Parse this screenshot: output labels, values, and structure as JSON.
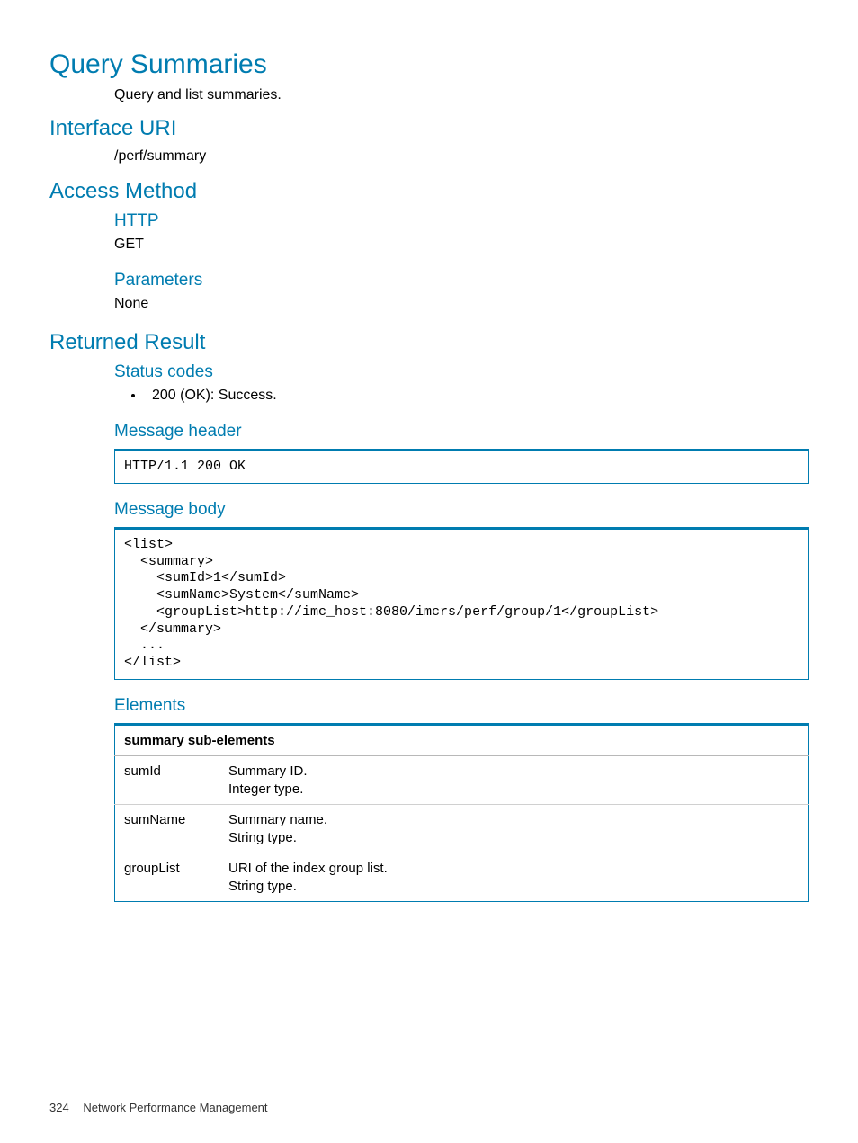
{
  "title": "Query Summaries",
  "desc": "Query and list summaries.",
  "interface_uri_heading": "Interface URI",
  "interface_uri": "/perf/summary",
  "access_method_heading": "Access Method",
  "http_heading": "HTTP",
  "http_value": "GET",
  "parameters_heading": "Parameters",
  "parameters_value": "None",
  "returned_result_heading": "Returned Result",
  "status_codes_heading": "Status codes",
  "status_codes_item": "200 (OK): Success.",
  "message_header_heading": "Message header",
  "message_header_code": "HTTP/1.1 200 OK",
  "message_body_heading": "Message body",
  "message_body_code": "<list>\n  <summary>\n    <sumId>1</sumId>\n    <sumName>System</sumName>\n    <groupList>http://imc_host:8080/imcrs/perf/group/1</groupList>\n  </summary>\n  ...\n</list>",
  "elements_heading": "Elements",
  "elements_table_header": "summary sub-elements",
  "elements_rows": [
    {
      "name": "sumId",
      "desc1": "Summary ID.",
      "desc2": "Integer type."
    },
    {
      "name": "sumName",
      "desc1": "Summary name.",
      "desc2": "String type."
    },
    {
      "name": "groupList",
      "desc1": "URI of the index group list.",
      "desc2": "String type."
    }
  ],
  "footer_page": "324",
  "footer_text": "Network Performance Management"
}
